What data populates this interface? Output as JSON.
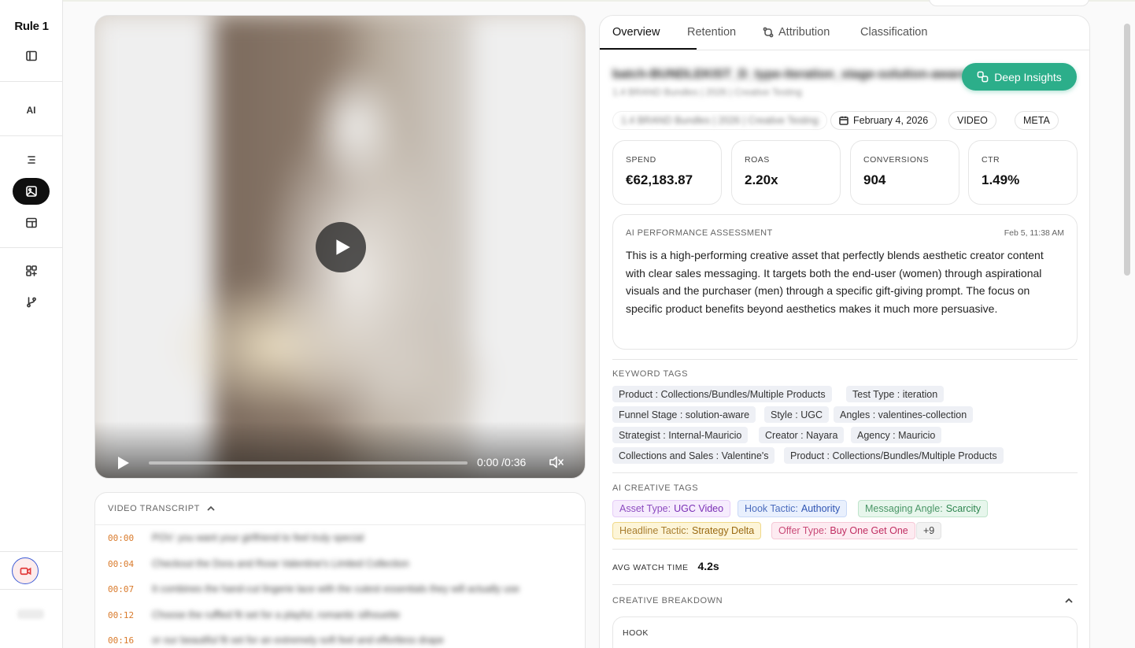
{
  "app": {
    "logo": "Rule 1"
  },
  "sidebar": {
    "ai_label": "AI",
    "items": [
      {
        "name": "sidebar-toggle",
        "icon": "sidebar-panel-icon"
      },
      {
        "name": "ai",
        "icon": "ai-text"
      },
      {
        "name": "list",
        "icon": "list-icon"
      },
      {
        "name": "creatives",
        "icon": "image-icon",
        "active": true
      },
      {
        "name": "layout",
        "icon": "layout-icon"
      },
      {
        "name": "add-widget",
        "icon": "grid-plus-icon"
      },
      {
        "name": "branches",
        "icon": "git-branch-icon"
      }
    ],
    "record_icon": "video-camera-icon",
    "footer_text": "•••••"
  },
  "video": {
    "time_display": "0:00 /0:36",
    "progress": 0.0,
    "muted": true
  },
  "transcript": {
    "title": "VIDEO TRANSCRIPT",
    "rows": [
      {
        "time": "00:00",
        "text": "POV: you want your girlfriend to feel truly special"
      },
      {
        "time": "00:04",
        "text": "Checkout the Dora and Rose Valentine's Limited Collection"
      },
      {
        "time": "00:07",
        "text": "It combines the hand-cut lingerie lace with the cutest essentials they will actually use"
      },
      {
        "time": "00:12",
        "text": "Choose the ruffled fit set for a playful, romantic silhouette"
      },
      {
        "time": "00:16",
        "text": "or our beautiful fit set for an extremely soft feel and effortless drape"
      }
    ]
  },
  "tabs": [
    {
      "label": "Overview",
      "active": true
    },
    {
      "label": "Retention"
    },
    {
      "label": "Attribution",
      "icon": "attribution-icon"
    },
    {
      "label": "Classification"
    }
  ],
  "asset": {
    "name": "batch-BUNDLEKIST_D_type-iteration_stage-solution-aware",
    "subtitle": "1.4 BRAND Bundles | 2026 | Creative Testing",
    "campaign_chip": "1.4 BRAND Bundles | 2026 | Creative Testing",
    "date": "February 4, 2026",
    "format": "VIDEO",
    "platform": "META"
  },
  "deep_insights": {
    "label": "Deep Insights",
    "icon": "insights-icon"
  },
  "stats": [
    {
      "label": "SPEND",
      "value": "€62,183.87"
    },
    {
      "label": "ROAS",
      "value": "2.20x"
    },
    {
      "label": "CONVERSIONS",
      "value": "904"
    },
    {
      "label": "CTR",
      "value": "1.49%"
    }
  ],
  "assessment": {
    "title": "AI PERFORMANCE ASSESSMENT",
    "date": "Feb 5, 11:38 AM",
    "text": "This is a high-performing creative asset that perfectly blends aesthetic creator content with clear sales messaging. It targets both the end-user (women) through aspirational visuals and the purchaser (men) through a specific gift-giving prompt. The focus on specific product benefits beyond aesthetics makes it much more persuasive."
  },
  "keyword_tags": {
    "title": "KEYWORD TAGS",
    "tags": [
      "Product : Collections/Bundles/Multiple Products",
      "Test Type : iteration",
      "Funnel Stage : solution-aware",
      "Style : UGC",
      "Angles : valentines-collection",
      "Strategist : Internal-Mauricio",
      "Creator : Nayara",
      "Agency : Mauricio",
      "Collections and Sales : Valentine's",
      "Product : Collections/Bundles/Multiple Products"
    ]
  },
  "ai_tags": {
    "title": "AI CREATIVE TAGS",
    "tags": [
      {
        "key": "Asset Type:",
        "value": "UGC Video",
        "color": "#7a2fb5"
      },
      {
        "key": "Hook Tactic:",
        "value": "Authority",
        "color": "#2f55b3"
      },
      {
        "key": "Messaging Angle:",
        "value": "Scarcity",
        "color": "#2f8650"
      },
      {
        "key": "Headline Tactic:",
        "value": "Strategy Delta",
        "color": "#9a6a12"
      },
      {
        "key": "Offer Type:",
        "value": "Buy One Get One",
        "color": "#c02e62"
      }
    ],
    "more": "+9"
  },
  "watch_time": {
    "label": "AVG WATCH TIME",
    "value": "4.2s"
  },
  "breakdown": {
    "title": "CREATIVE BREAKDOWN",
    "hook_label": "HOOK"
  }
}
